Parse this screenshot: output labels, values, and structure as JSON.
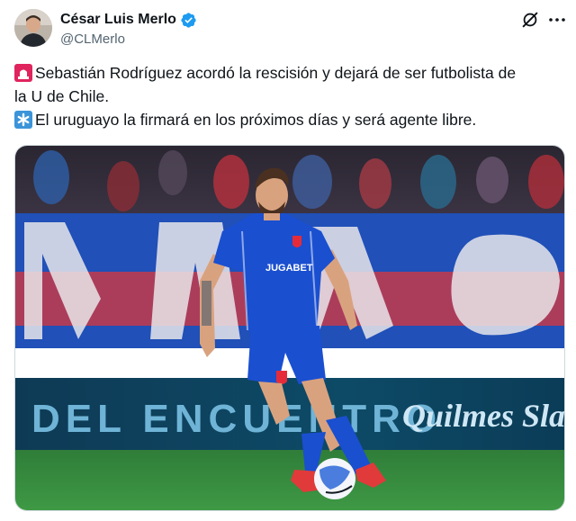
{
  "author": {
    "name": "César Luis Merlo",
    "handle": "@CLMerlo",
    "verified": true
  },
  "icons": {
    "verified": "verified-badge-icon",
    "grok": "grok-icon",
    "more": "more-options-icon",
    "emoji1": "siren-emoji-icon",
    "emoji2": "asterisk-emoji-icon"
  },
  "tweet": {
    "line1": "Sebastián Rodríguez acordó la rescisión y dejará de ser futbolista de",
    "line2": "la U de Chile.",
    "line3": "El uruguayo la firmará en los próximos días y será agente libre."
  },
  "media": {
    "board_text": "DEL ENCUENTRO",
    "sponsor_text": "Quilmes Sla",
    "shirt_text": "JUGABET"
  },
  "colors": {
    "verified_blue": "#1d9bf0",
    "text": "#0f1419",
    "muted": "#536471",
    "kit_blue": "#1a4fd0"
  }
}
